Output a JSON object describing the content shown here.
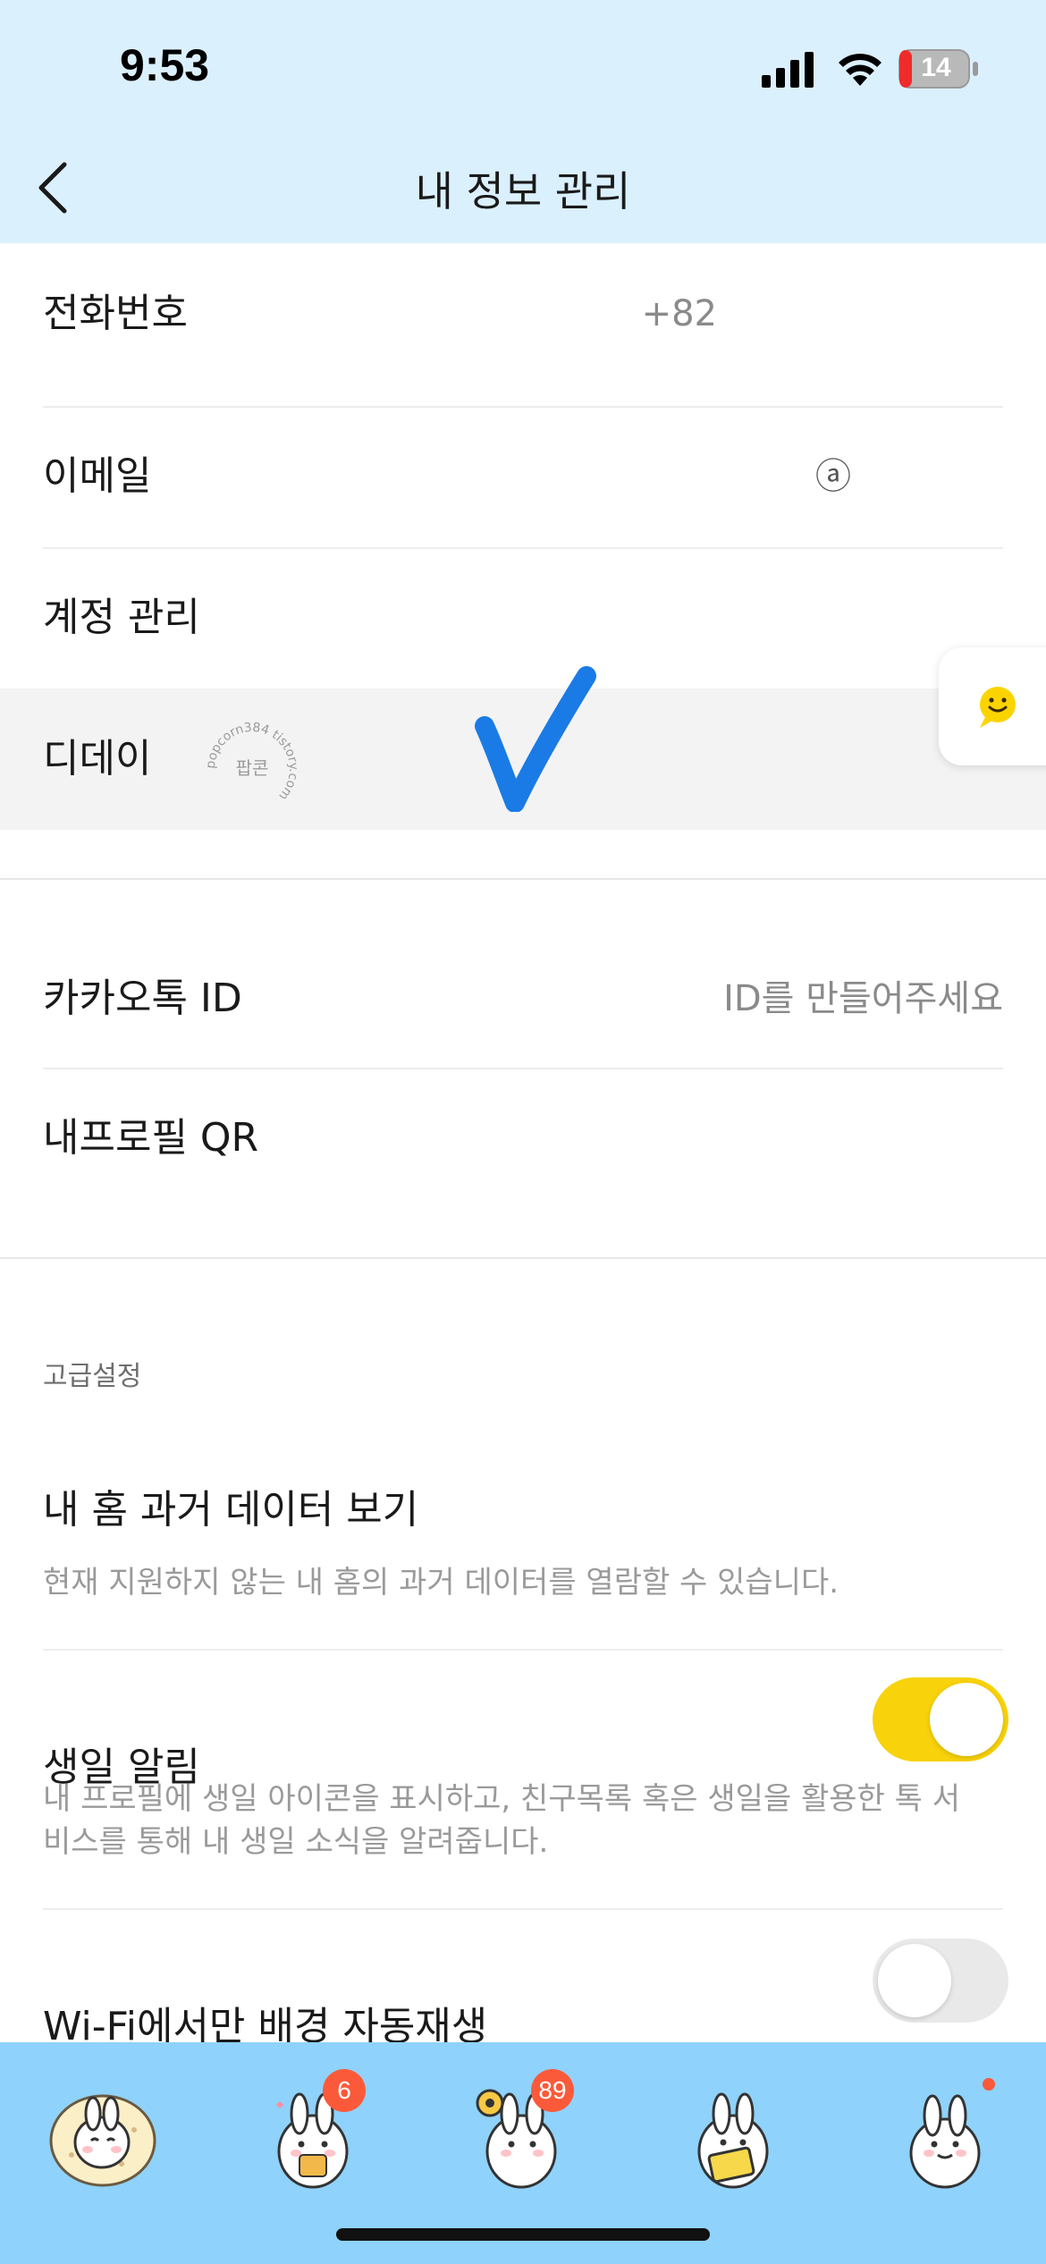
{
  "status_bar": {
    "time": "9:53",
    "battery": "14"
  },
  "nav": {
    "title": "내 정보 관리"
  },
  "account_rows": [
    {
      "label": "전화번호",
      "value": "+82"
    },
    {
      "label": "이메일",
      "value": "ⓐ"
    },
    {
      "label": "계정 관리",
      "value": ""
    },
    {
      "label": "디데이",
      "value": ""
    }
  ],
  "id_rows": [
    {
      "label": "카카오톡 ID",
      "value": "ID를 만들어주세요"
    },
    {
      "label": "내프로필 QR",
      "value": ""
    }
  ],
  "advanced": {
    "header": "고급설정",
    "items": [
      {
        "title": "내 홈 과거 데이터 보기",
        "desc": "현재 지원하지 않는 내 홈의 과거 데이터를 열람할 수 있습니다."
      },
      {
        "title": "생일 알림",
        "desc": "내 프로필에 생일 아이콘을 표시하고, 친구목록 혹은 생일을 활용한 톡 서비스를 통해 내 생일 소식을 알려줍니다.",
        "toggle": true
      },
      {
        "title": "Wi-Fi에서만 배경 자동재생",
        "desc": "",
        "toggle": false
      }
    ]
  },
  "stamp": {
    "text": "팝콘",
    "ring": "popcorn384 tistory.com"
  },
  "tab_bar": {
    "tabs": [
      {
        "icon": "friends-tab-icon",
        "badge": ""
      },
      {
        "icon": "chats-tab-icon",
        "badge": "6"
      },
      {
        "icon": "openchat-tab-icon",
        "badge": "89"
      },
      {
        "icon": "shopping-tab-icon",
        "badge": ""
      },
      {
        "icon": "more-tab-icon",
        "badge": "dot"
      }
    ]
  },
  "colors": {
    "header_bg": "#dbf0fd",
    "tab_bar_bg": "#8fd2fb",
    "toggle_on": "#f8d20a",
    "badge": "#fa5a3a",
    "checkmark": "#1a7be6"
  }
}
